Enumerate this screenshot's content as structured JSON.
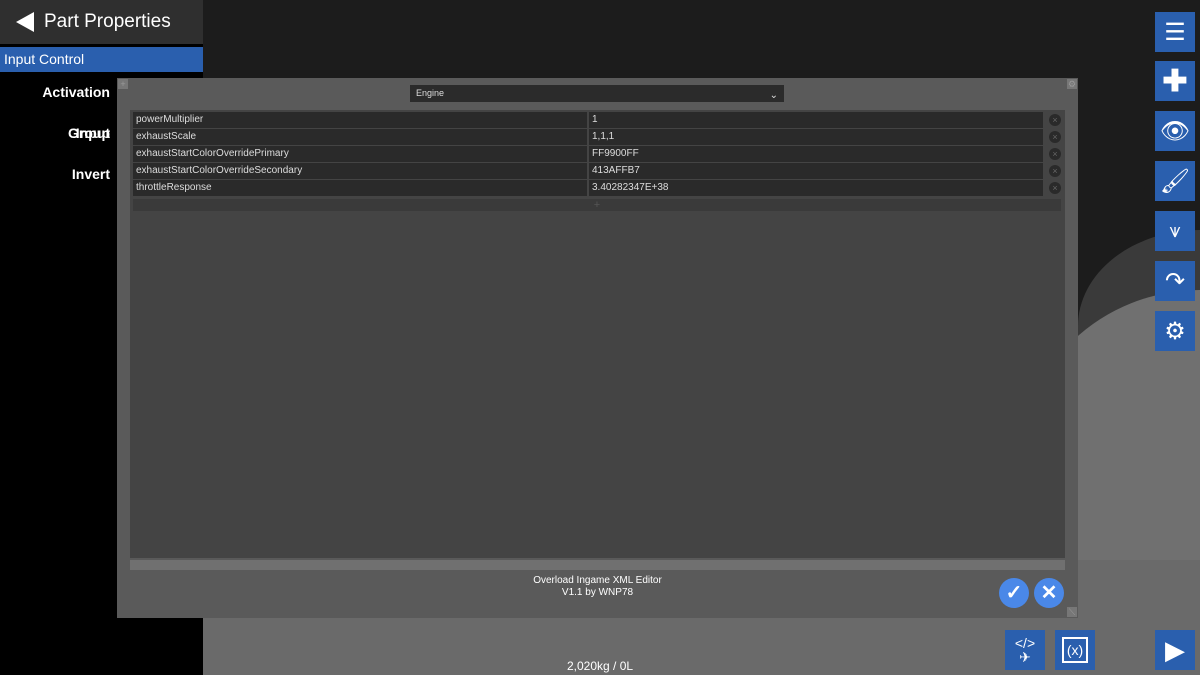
{
  "sidebar": {
    "title": "Part Properties",
    "selected": "Input Control",
    "items": [
      "Activation Group",
      "Input",
      "Invert"
    ]
  },
  "editor": {
    "part_type": "Engine",
    "rows": [
      {
        "key": "powerMultiplier",
        "value": "1"
      },
      {
        "key": "exhaustScale",
        "value": "1,1,1"
      },
      {
        "key": "exhaustStartColorOverridePrimary",
        "value": "FF9900FF"
      },
      {
        "key": "exhaustStartColorOverrideSecondary",
        "value": "413AFFB7"
      },
      {
        "key": "throttleResponse",
        "value": "3.40282347E+38"
      }
    ],
    "footer_line1": "Overload Ingame XML Editor",
    "footer_line2": "V1.1 by WNP78"
  },
  "status": {
    "mass": "2,020kg / 0L"
  },
  "colors": {
    "accent": "#2a5fae",
    "confirm": "#4a88e8"
  }
}
